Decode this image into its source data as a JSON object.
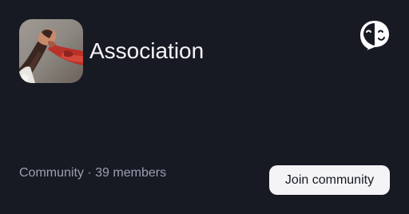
{
  "community": {
    "name": "Association",
    "type_label": "Community",
    "separator": "·",
    "member_count": "39 members"
  },
  "actions": {
    "join_label": "Join community"
  },
  "icons": {
    "avatar": "handshake-meme-image",
    "brand": "theater-mask-logo-icon"
  },
  "colors": {
    "background": "#171a23",
    "title_text": "#f4f5f7",
    "meta_text": "#9aa0b3",
    "button_bg": "#f4f4f6",
    "button_text": "#171a23"
  }
}
